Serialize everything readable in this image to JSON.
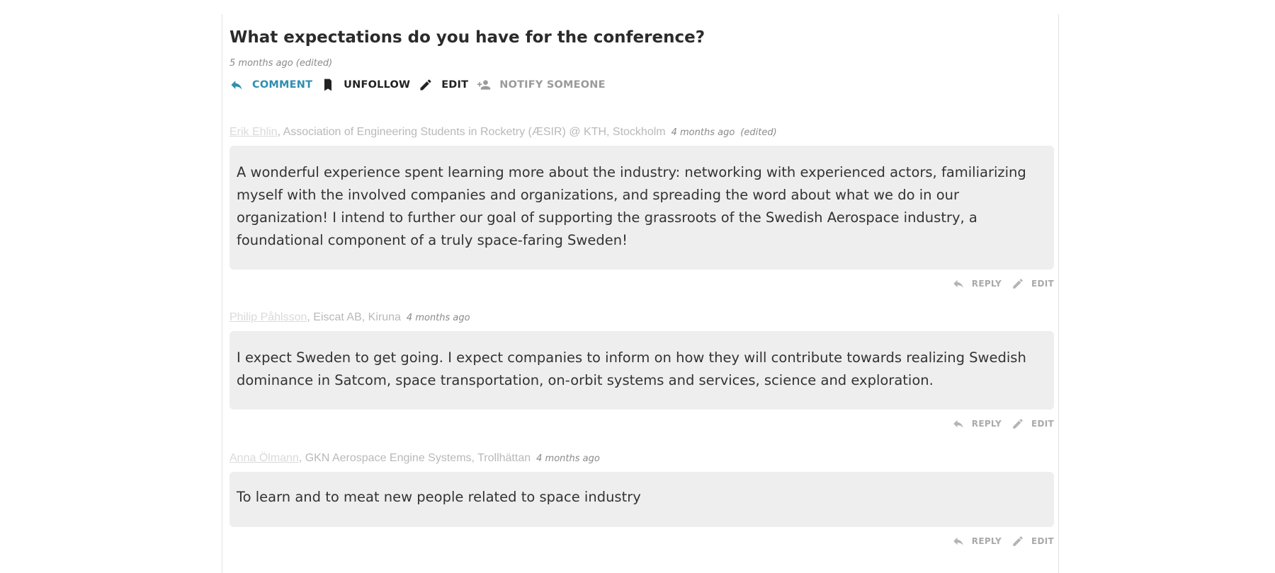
{
  "question": {
    "title": "What expectations do you have for the conference?",
    "meta": "5 months ago (edited)"
  },
  "actions": {
    "comment": "COMMENT",
    "unfollow": "UNFOLLOW",
    "edit": "EDIT",
    "notify": "NOTIFY SOMEONE"
  },
  "comments": [
    {
      "author": "Erik Ehlin",
      "affiliation": ", Association of Engineering Students in Rocketry (ÆSIR) @ KTH, Stockholm",
      "time": "4 months ago",
      "edited": "(edited)",
      "body": "A wonderful experience spent learning more about the industry: networking with experienced actors, familiarizing myself with the involved companies and organizations, and spreading the word about what we do in our organization! I intend to further our goal of supporting the grassroots of the Swedish Aerospace industry, a foundational component of a truly space-faring Sweden!",
      "reply": "REPLY",
      "edit": "EDIT"
    },
    {
      "author": "Philip Påhlsson",
      "affiliation": ", Eiscat AB, Kiruna",
      "time": "4 months ago",
      "edited": "",
      "body": "I expect Sweden to get going. I expect companies to inform on how they will contribute towards realizing Swedish dominance in Satcom, space transportation, on-orbit systems and services, science and exploration.",
      "reply": "REPLY",
      "edit": "EDIT"
    },
    {
      "author": "Anna Ölmann",
      "affiliation": ", GKN Aerospace Engine Systems, Trollhättan",
      "time": "4 months ago",
      "edited": "",
      "body": "To learn and to meat new people related to space industry",
      "reply": "REPLY",
      "edit": "EDIT"
    }
  ],
  "colors": {
    "accent": "#2e8fb0",
    "bubble": "#eeeeee",
    "muted": "#9a9a9a"
  }
}
